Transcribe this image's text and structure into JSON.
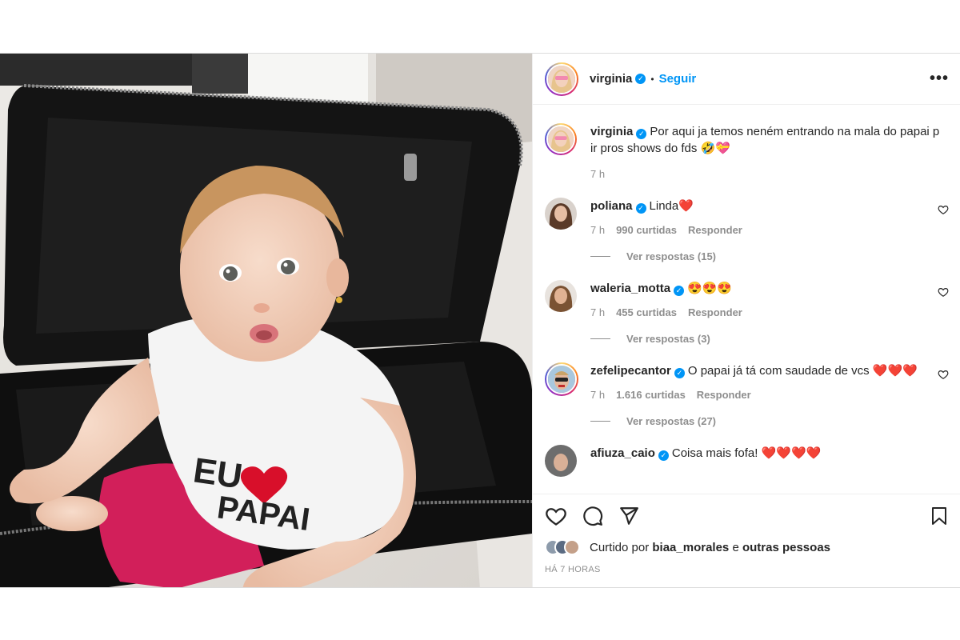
{
  "post": {
    "author": "virginia",
    "follow_label": "Seguir",
    "separator": "•",
    "more_label": "•••",
    "caption_user": "virginia",
    "caption": "Por aqui ja temos neném entrando na mala do papai p ir pros shows do fds 🤣💝",
    "caption_time": "7 h",
    "shirt_text": "EU ♥ PAPAI"
  },
  "comments": [
    {
      "user": "poliana",
      "text": "Linda❤️",
      "time": "7 h",
      "likes": "990 curtidas",
      "reply": "Responder",
      "replies": "Ver respostas (15)"
    },
    {
      "user": "waleria_motta",
      "text": "😍😍😍",
      "time": "7 h",
      "likes": "455 curtidas",
      "reply": "Responder",
      "replies": "Ver respostas (3)"
    },
    {
      "user": "zefelipecantor",
      "text": "O papai já tá com saudade de vcs ❤️❤️❤️",
      "time": "7 h",
      "likes": "1.616 curtidas",
      "reply": "Responder",
      "replies": "Ver respostas (27)"
    },
    {
      "user": "afiuza_caio",
      "text": "Coisa mais fofa! ❤️❤️❤️❤️"
    }
  ],
  "likes_bar": {
    "prefix": "Curtido por",
    "user": "biaa_morales",
    "conj": "e",
    "others": "outras pessoas",
    "time_ago": "HÁ 7 HORAS"
  },
  "icons": {
    "verified": "verified-badge",
    "like": "heart-icon",
    "comment": "comment-icon",
    "share": "paper-plane-icon",
    "save": "bookmark-icon"
  },
  "colors": {
    "accent": "#0095f6",
    "muted": "#8e8e8e",
    "text": "#262626"
  }
}
